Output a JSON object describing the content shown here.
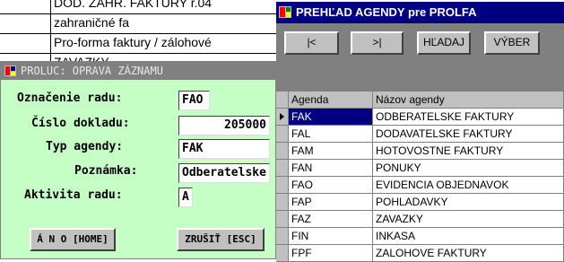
{
  "background_list": {
    "rows": [
      "DOD. ZAHR. FAKTÚRY r.04",
      "zahraničné fa",
      "Pro-forma faktury / zálohové",
      "ZAVAZKY"
    ]
  },
  "edit_dialog": {
    "title": "PROLUC: OPRAVA ZÁZNAMU",
    "fields": [
      {
        "label": "Označenie radu:",
        "value": "FAO"
      },
      {
        "label": "Číslo dokladu:",
        "value": "205000"
      },
      {
        "label": "Typ agendy:",
        "value": "FAK"
      },
      {
        "label": "Poznámka:",
        "value": "Odberatelske"
      },
      {
        "label": "Aktivita radu:",
        "value": "A"
      }
    ],
    "buttons": {
      "ok": "Á N O [HOME]",
      "cancel": "ZRUŠIŤ [ESC]"
    }
  },
  "lookup_dialog": {
    "title": "PREHĽAD AGENDY pre PROLFA",
    "buttons": {
      "first": "|<",
      "last": ">|",
      "search": "HĽADAJ",
      "select": "VÝBER"
    },
    "columns": [
      "Agenda",
      "Názov agendy"
    ],
    "rows": [
      {
        "code": "FAK",
        "name": "ODBERATELSKE FAKTURY",
        "selected": true
      },
      {
        "code": "FAL",
        "name": "DODAVATELSKE FAKTURY"
      },
      {
        "code": "FAM",
        "name": "HOTOVOSTNE FAKTURY"
      },
      {
        "code": "FAN",
        "name": "PONUKY"
      },
      {
        "code": "FAO",
        "name": "EVIDENCIA OBJEDNAVOK"
      },
      {
        "code": "FAP",
        "name": "POHLADAVKY"
      },
      {
        "code": "FAZ",
        "name": "ZAVAZKY"
      },
      {
        "code": "FIN",
        "name": "INKASA"
      },
      {
        "code": "FPF",
        "name": "ZALOHOVE FAKTURY"
      }
    ]
  },
  "colors": {
    "edit_dialog_bg": "#c6ffc6",
    "lookup_titlebar": "#000080",
    "selection": "#000080",
    "button_face": "#c0c0c0"
  },
  "icons": {
    "window": "app-window-icon",
    "row_pointer": "row-pointer-icon"
  }
}
